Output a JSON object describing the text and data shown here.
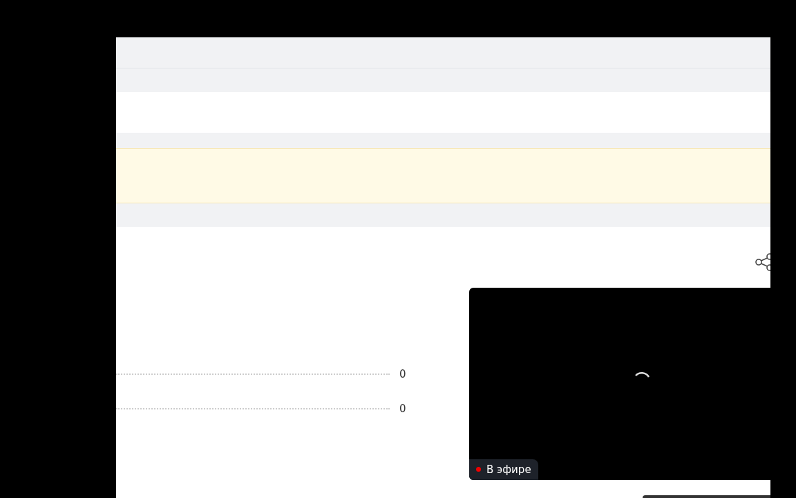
{
  "stats": [
    {
      "value": "0"
    },
    {
      "value": "0"
    }
  ],
  "video": {
    "live_badge": "В эфире"
  }
}
